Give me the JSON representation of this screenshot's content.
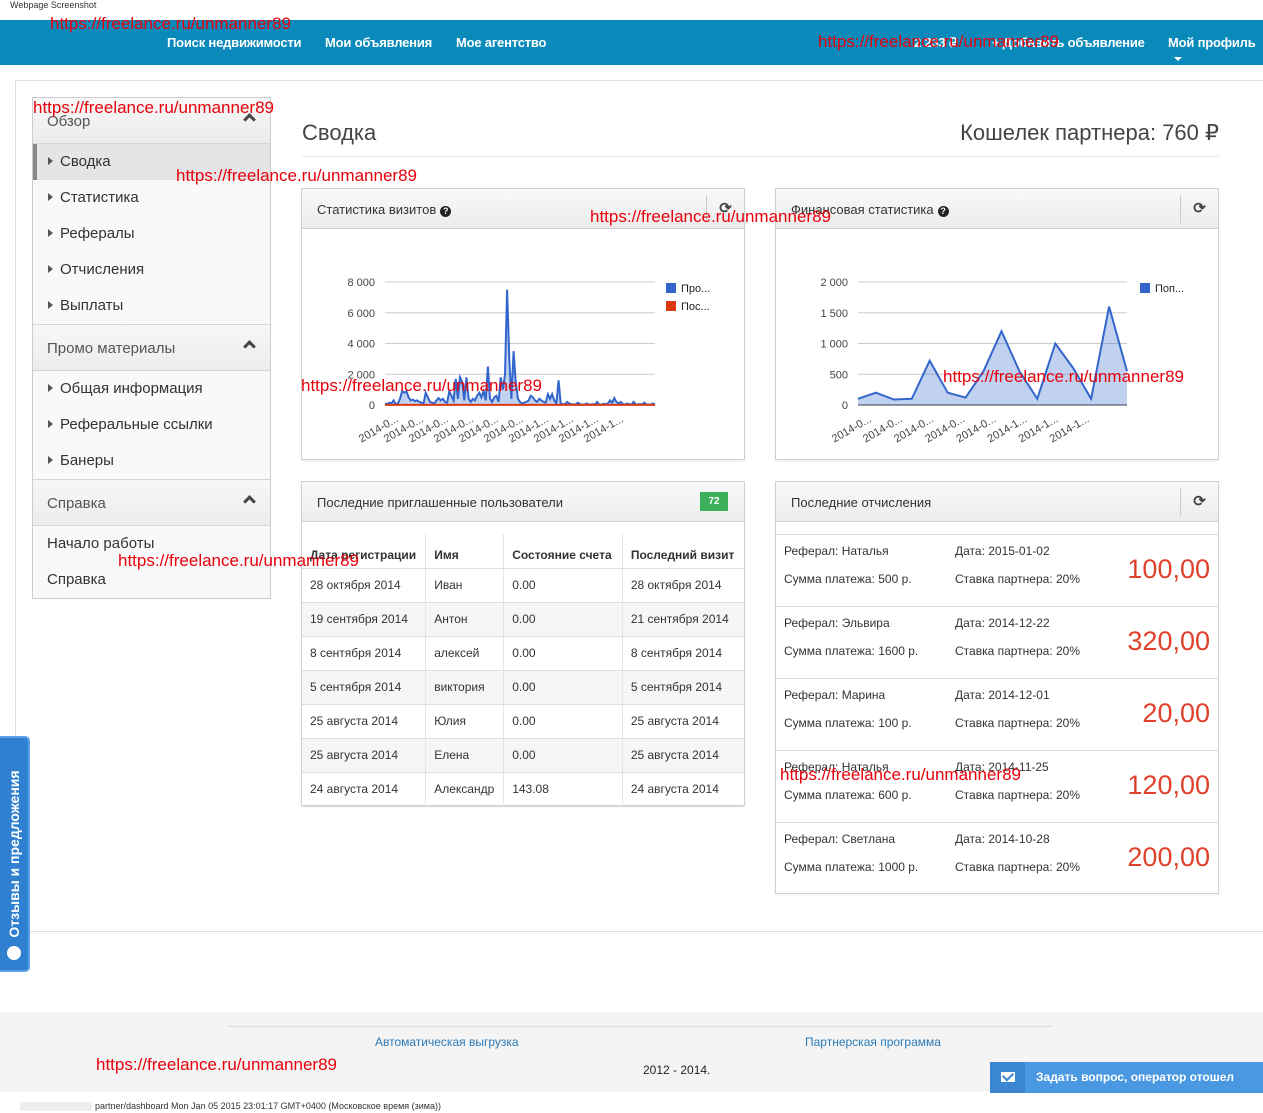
{
  "capture_label": "Webpage Screenshot",
  "watermark": "https://freelance.ru/unmanner89",
  "topnav": {
    "items": [
      "Поиск недвижимости",
      "Мои объявления",
      "Мое агентство"
    ],
    "balance": "2 233 ₽",
    "add_listing": "+ Добавить объявление",
    "profile": "Мой профиль"
  },
  "sidebar": {
    "sections": [
      {
        "title": "Обзор",
        "items": [
          "Сводка",
          "Статистика",
          "Рефералы",
          "Отчисления",
          "Выплаты"
        ],
        "active": "Сводка"
      },
      {
        "title": "Промо материалы",
        "items": [
          "Общая информация",
          "Реферальные ссылки",
          "Банеры"
        ]
      },
      {
        "title": "Справка",
        "items": [
          "Начало работы",
          "Справка"
        ]
      }
    ]
  },
  "header": {
    "title": "Сводка",
    "wallet": "Кошелек партнера: 760 ₽"
  },
  "visits_panel": {
    "title": "Статистика визитов",
    "help": "?"
  },
  "finance_panel": {
    "title": "Финансовая статистика",
    "help": "?"
  },
  "users_panel": {
    "title": "Последние приглашенные пользователи",
    "badge": "72",
    "columns": [
      "Дата регистрации",
      "Имя",
      "Состояние счета",
      "Последний визит"
    ],
    "rows": [
      [
        "28 октября 2014",
        "Иван",
        "0.00",
        "28 октября 2014"
      ],
      [
        "19 сентября 2014",
        "Антон",
        "0.00",
        "21 сентября 2014"
      ],
      [
        "8 сентября 2014",
        "алексей",
        "0.00",
        "8 сентября 2014"
      ],
      [
        "5 сентября 2014",
        "виктория",
        "0.00",
        "5 сентября 2014"
      ],
      [
        "25 августа 2014",
        "Юлия",
        "0.00",
        "25 августа 2014"
      ],
      [
        "25 августа 2014",
        "Елена",
        "0.00",
        "25 августа 2014"
      ],
      [
        "24 августа 2014",
        "Александр",
        "143.08",
        "24 августа 2014"
      ]
    ]
  },
  "payments_panel": {
    "title": "Последние отчисления",
    "items": [
      {
        "referral": "Реферал: Наталья",
        "date": "Дата: 2015-01-02",
        "sum": "Сумма платежа: 500 р.",
        "rate": "Ставка партнера: 20%",
        "amount": "100,00"
      },
      {
        "referral": "Реферал: Эльвира",
        "date": "Дата: 2014-12-22",
        "sum": "Сумма платежа: 1600 р.",
        "rate": "Ставка партнера: 20%",
        "amount": "320,00"
      },
      {
        "referral": "Реферал: Марина",
        "date": "Дата: 2014-12-01",
        "sum": "Сумма платежа: 100 р.",
        "rate": "Ставка партнера: 20%",
        "amount": "20,00"
      },
      {
        "referral": "Реферал: Наталья",
        "date": "Дата: 2014-11-25",
        "sum": "Сумма платежа: 600 р.",
        "rate": "Ставка партнера: 20%",
        "amount": "120,00"
      },
      {
        "referral": "Реферал: Светлана",
        "date": "Дата: 2014-10-28",
        "sum": "Сумма платежа: 1000 р.",
        "rate": "Ставка партнера: 20%",
        "amount": "200,00"
      }
    ]
  },
  "feedback_tab": "Отзывы и предложения",
  "footer": {
    "links": [
      "Автоматическая выгрузка",
      "Партнерская программа"
    ],
    "copyright": "2012 - 2014."
  },
  "chat_button": "Задать вопрос, оператор отошел",
  "status_line": "partner/dashboard Mon Jan 05 2015 23:01:17 GMT+0400 (Московское время (зима))",
  "colors": {
    "nav": "#0a8abb",
    "series_blue": "#3366cc",
    "series_red": "#dc3912",
    "amount_red": "#e0412b",
    "badge_green": "#3caf5a"
  },
  "chart_data": [
    {
      "type": "area",
      "title": "Статистика визитов",
      "ylim": [
        0,
        8000
      ],
      "yticks": [
        "0",
        "2 000",
        "4 000",
        "6 000",
        "8 000"
      ],
      "xticks": [
        "2014-0...",
        "2014-0...",
        "2014-0...",
        "2014-0...",
        "2014-0...",
        "2014-0...",
        "2014-1...",
        "2014-1...",
        "2014-1...",
        "2014-1..."
      ],
      "legend": [
        "Про...",
        "Пос..."
      ],
      "legend_position": "right",
      "grid": true,
      "series": [
        {
          "name": "Про...",
          "color": "#3366cc",
          "values": [
            100,
            50,
            150,
            100,
            300,
            50,
            100,
            400,
            900,
            800,
            900,
            500,
            300,
            350,
            250,
            300,
            200,
            150,
            100,
            800,
            500,
            200,
            150,
            100,
            300,
            450,
            300,
            400,
            200,
            150,
            900,
            600,
            300,
            1700,
            400,
            1800,
            1500,
            300,
            1800,
            400,
            200,
            400,
            300,
            600,
            800,
            500,
            900,
            300,
            2500,
            400,
            200,
            500,
            600,
            200,
            1800,
            1000,
            2000,
            7500,
            3000,
            400,
            3500,
            1500,
            400,
            200,
            100,
            150,
            200,
            300,
            600,
            500,
            300,
            200,
            400,
            300,
            200,
            150,
            700,
            400,
            700,
            300,
            100,
            1600,
            100,
            50,
            50,
            200,
            100,
            50,
            30,
            50,
            150,
            50,
            30,
            20,
            100,
            40,
            20,
            50,
            30,
            200,
            40,
            20,
            80,
            50,
            100,
            300,
            150,
            450,
            200,
            100,
            200,
            50,
            30,
            100,
            60,
            20,
            200,
            30,
            40,
            60,
            30,
            150,
            40,
            30,
            20,
            100,
            30
          ]
        },
        {
          "name": "Пос...",
          "color": "#dc3912",
          "values": [
            5,
            5,
            5,
            5,
            5,
            5,
            5,
            5,
            5,
            5
          ]
        }
      ]
    },
    {
      "type": "area",
      "title": "Финансовая статистика",
      "ylim": [
        0,
        2000
      ],
      "yticks": [
        "0",
        "500",
        "1 000",
        "1 500",
        "2 000"
      ],
      "xticks": [
        "2014-0...",
        "2014-0...",
        "2014-0...",
        "2014-0...",
        "2014-0...",
        "2014-1...",
        "2014-1...",
        "2014-1..."
      ],
      "legend": [
        "Поп..."
      ],
      "legend_position": "right",
      "grid": true,
      "series": [
        {
          "name": "Поп...",
          "color": "#3366cc",
          "values": [
            100,
            200,
            90,
            100,
            720,
            200,
            120,
            550,
            1200,
            550,
            100,
            1000,
            600,
            100,
            1600,
            550
          ]
        }
      ]
    }
  ]
}
